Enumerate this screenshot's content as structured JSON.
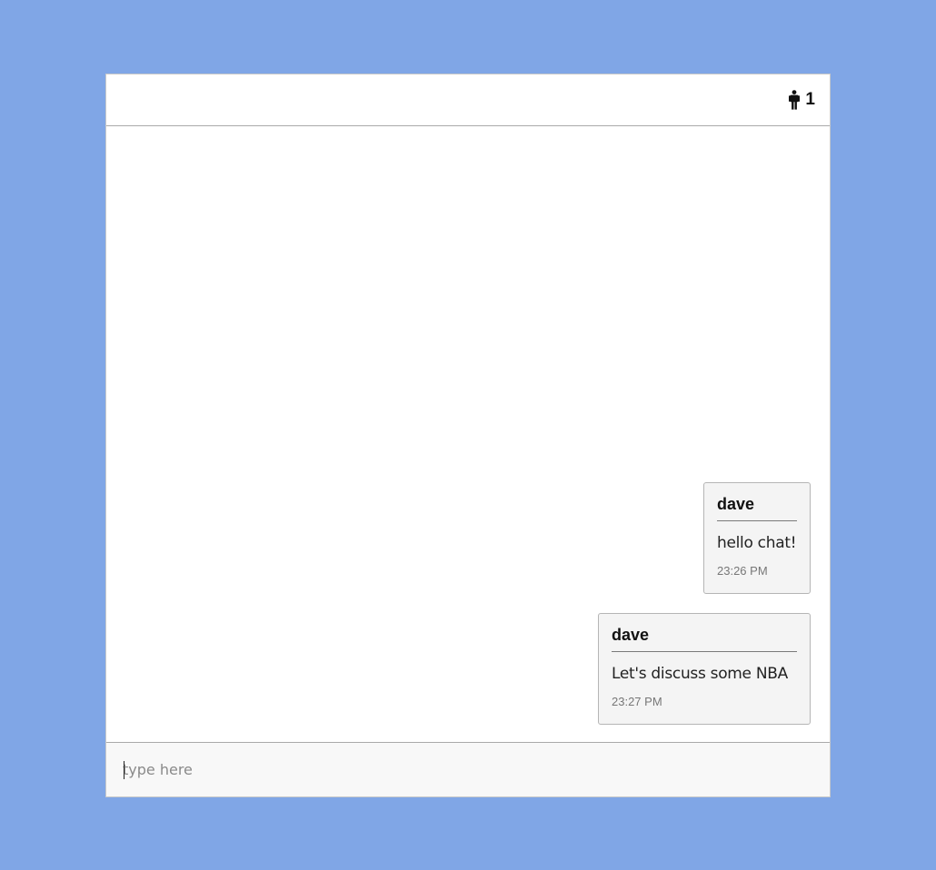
{
  "header": {
    "user_icon": "person-icon",
    "user_count": "1"
  },
  "messages": [
    {
      "author": "dave",
      "text": "hello chat!",
      "time": "23:26 PM"
    },
    {
      "author": "dave",
      "text": "Let's discuss some NBA",
      "time": "23:27 PM"
    }
  ],
  "composer": {
    "value": "",
    "placeholder": "type here"
  },
  "colors": {
    "background": "#80a6e6",
    "panel": "#ffffff",
    "bubble": "#f4f4f4"
  }
}
